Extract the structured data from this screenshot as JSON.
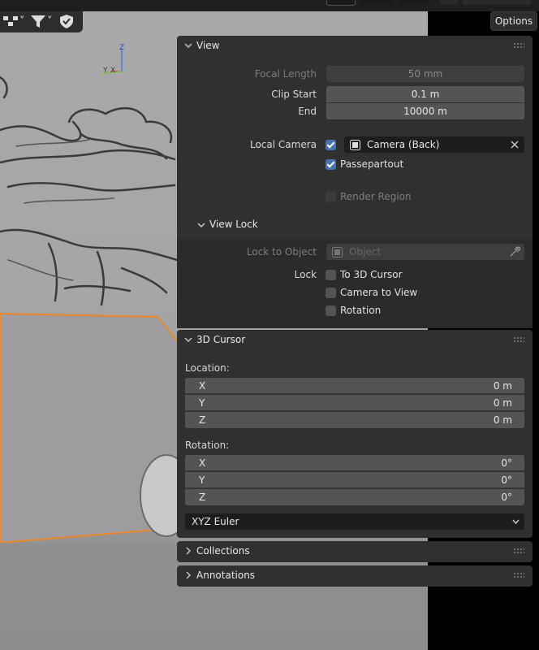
{
  "header": {
    "options_label": "Options"
  },
  "view_panel": {
    "title": "View",
    "focal_length_label": "Focal Length",
    "focal_length_value": "50 mm",
    "clip_start_label": "Clip Start",
    "clip_start_value": "0.1 m",
    "end_label": "End",
    "end_value": "10000 m",
    "local_camera_label": "Local Camera",
    "local_camera_checked": true,
    "camera_value": "Camera (Back)",
    "passepartout_label": "Passepartout",
    "passepartout_checked": true,
    "render_region_label": "Render Region",
    "render_region_checked": false,
    "view_lock": {
      "title": "View Lock",
      "lock_to_object_label": "Lock to Object",
      "object_placeholder": "Object",
      "lock_label": "Lock",
      "to_3d_cursor_label": "To 3D Cursor",
      "camera_to_view_label": "Camera to View",
      "rotation_label": "Rotation"
    }
  },
  "cursor_panel": {
    "title": "3D Cursor",
    "location_label": "Location:",
    "location": [
      {
        "axis": "X",
        "value": "0 m"
      },
      {
        "axis": "Y",
        "value": "0 m"
      },
      {
        "axis": "Z",
        "value": "0 m"
      }
    ],
    "rotation_label": "Rotation:",
    "rotation": [
      {
        "axis": "X",
        "value": "0°"
      },
      {
        "axis": "Y",
        "value": "0°"
      },
      {
        "axis": "Z",
        "value": "0°"
      }
    ],
    "rotation_mode": "XYZ Euler"
  },
  "collections_panel": {
    "title": "Collections"
  },
  "annotations_panel": {
    "title": "Annotations"
  },
  "gizmo": {
    "x": "X",
    "y": "Y",
    "z": "Z"
  },
  "colors": {
    "accent": "#4772b3",
    "selection_outline": "#e8882a",
    "panel_bg": "#303030"
  }
}
